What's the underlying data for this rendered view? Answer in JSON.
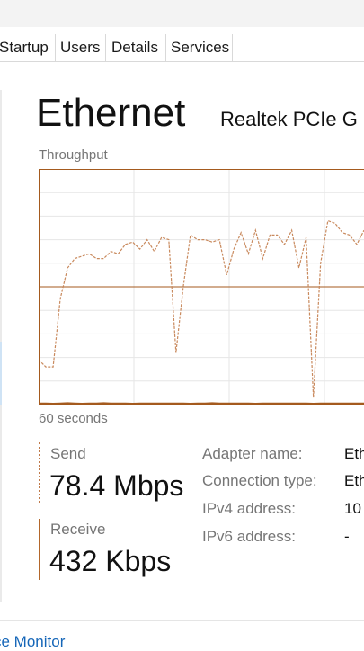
{
  "tabs": [
    {
      "label": "Startup"
    },
    {
      "label": "Users"
    },
    {
      "label": "Details"
    },
    {
      "label": "Services"
    }
  ],
  "adapter": {
    "title": "Ethernet",
    "subtitle": "Realtek PCIe G"
  },
  "graph": {
    "caption": "Throughput",
    "time_label": "60 seconds",
    "send_color": "#c98a5e",
    "receive_color": "#a45a1e",
    "grid_color": "#e6e6e6",
    "border_color": "#a45a1e",
    "send_series": [
      0.81,
      0.84,
      0.84,
      0.55,
      0.42,
      0.38,
      0.37,
      0.36,
      0.38,
      0.38,
      0.35,
      0.36,
      0.32,
      0.31,
      0.34,
      0.3,
      0.35,
      0.29,
      0.3,
      0.78,
      0.5,
      0.28,
      0.3,
      0.3,
      0.31,
      0.3,
      0.45,
      0.34,
      0.27,
      0.36,
      0.26,
      0.38,
      0.28,
      0.28,
      0.32,
      0.26,
      0.42,
      0.29,
      0.97,
      0.4,
      0.22,
      0.23,
      0.27,
      0.28,
      0.32,
      0.26
    ],
    "receive_series": [
      0.995,
      0.995,
      0.996,
      0.995,
      0.994,
      0.995,
      0.996,
      0.995,
      0.995,
      0.994,
      0.995,
      0.995,
      0.995,
      0.996,
      0.995,
      0.995,
      0.995,
      0.995,
      0.995,
      0.995,
      0.995,
      0.996,
      0.995,
      0.995,
      0.994,
      0.995,
      0.995,
      0.995,
      0.995,
      0.995,
      0.996,
      0.995,
      0.995,
      0.995,
      0.995,
      0.995,
      0.995,
      0.995,
      0.996,
      0.995,
      0.995,
      0.995,
      0.995,
      0.995,
      0.995,
      0.995
    ]
  },
  "metrics": {
    "send_label": "Send",
    "send_value": "78.4 Mbps",
    "receive_label": "Receive",
    "receive_value": "432 Kbps"
  },
  "properties": [
    {
      "label": "Adapter name:",
      "value": "Eth"
    },
    {
      "label": "Connection type:",
      "value": "Eth"
    },
    {
      "label": "IPv4 address:",
      "value": "10"
    },
    {
      "label": "IPv6 address:",
      "value": "-"
    }
  ],
  "footer": {
    "link_label": "ce Monitor"
  }
}
